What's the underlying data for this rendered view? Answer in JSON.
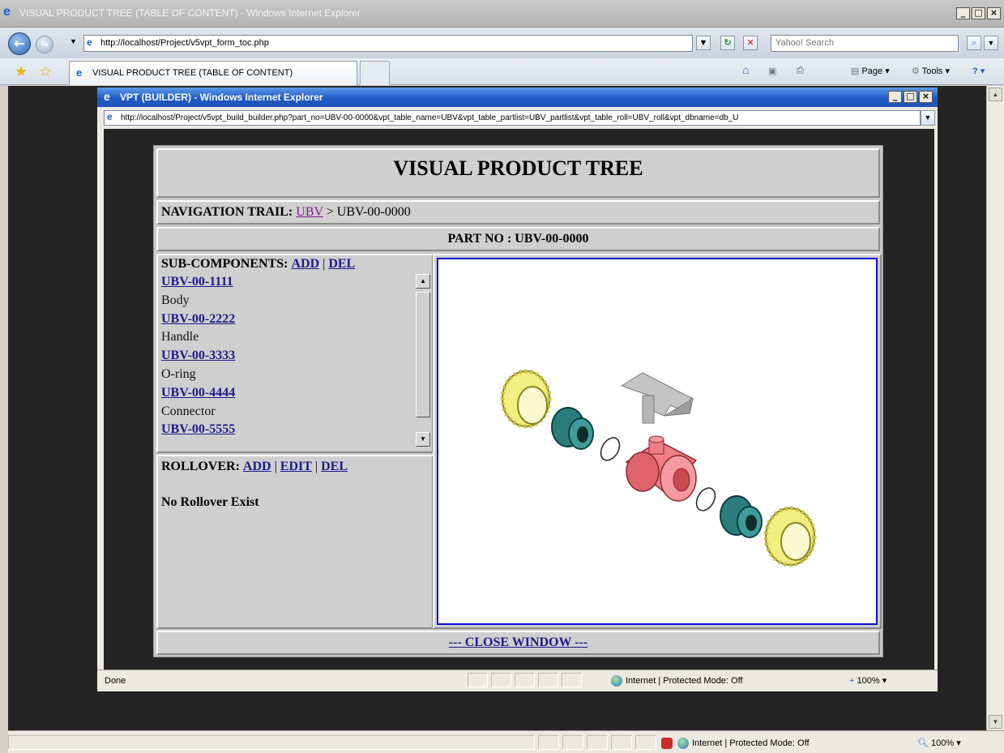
{
  "outer_window": {
    "title": "VISUAL PRODUCT TREE (TABLE OF CONTENT) - Windows Internet Explorer",
    "address": "http://localhost/Project/v5vpt_form_toc.php",
    "search_placeholder": "Yahoo! Search",
    "tab_title": "VISUAL PRODUCT TREE (TABLE OF CONTENT)",
    "commands": {
      "page": "Page",
      "tools": "Tools"
    },
    "status": {
      "zone": "Internet | Protected Mode: Off",
      "zoom": "100%"
    }
  },
  "popup_window": {
    "title": "VPT (BUILDER) - Windows Internet Explorer",
    "address": "http://localhost/Project/v5vpt_build_builder.php?part_no=UBV-00-0000&vpt_table_name=UBV&vpt_table_partlist=UBV_partlist&vpt_table_roll=UBV_roll&vpt_dbname=db_U",
    "status": {
      "left": "Done",
      "zone": "Internet | Protected Mode: Off",
      "zoom": "100%"
    }
  },
  "page": {
    "heading": "VISUAL PRODUCT TREE",
    "nav_trail_label": "NAVIGATION TRAIL:",
    "nav_trail_link": "UBV",
    "nav_trail_current": "> UBV-00-0000",
    "part_no_label": "PART NO : UBV-00-0000",
    "subcomponents_label": "SUB-COMPONENTS:",
    "subcomponents_add": "ADD",
    "subcomponents_del": "DEL",
    "separator": "|",
    "subcomponents": [
      {
        "code": "UBV-00-1111",
        "name": "Body"
      },
      {
        "code": "UBV-00-2222",
        "name": "Handle"
      },
      {
        "code": "UBV-00-3333",
        "name": "O-ring"
      },
      {
        "code": "UBV-00-4444",
        "name": "Connector"
      },
      {
        "code": "UBV-00-5555",
        "name": ""
      }
    ],
    "rollover_label": "ROLLOVER:",
    "rollover_add": "ADD",
    "rollover_edit": "EDIT",
    "rollover_del": "DEL",
    "rollover_message": "No Rollover Exist",
    "close_link": "--- CLOSE WINDOW ---"
  },
  "colors": {
    "link": "#1f1a8b",
    "visited_link": "#7a1f86",
    "image_frame": "#0c0cd9",
    "nut_yellow": "#f2ee80",
    "sleeve_teal": "#2b7d7d",
    "body_red": "#f07c84",
    "handle_grey": "#c4c4c4"
  },
  "icons": [
    "back-icon",
    "forward-icon",
    "ie-icon",
    "refresh-icon",
    "stop-icon",
    "search-icon",
    "favorites-icon",
    "home-icon",
    "feeds-icon",
    "print-icon",
    "help-icon",
    "globe-icon",
    "zoom-icon"
  ]
}
